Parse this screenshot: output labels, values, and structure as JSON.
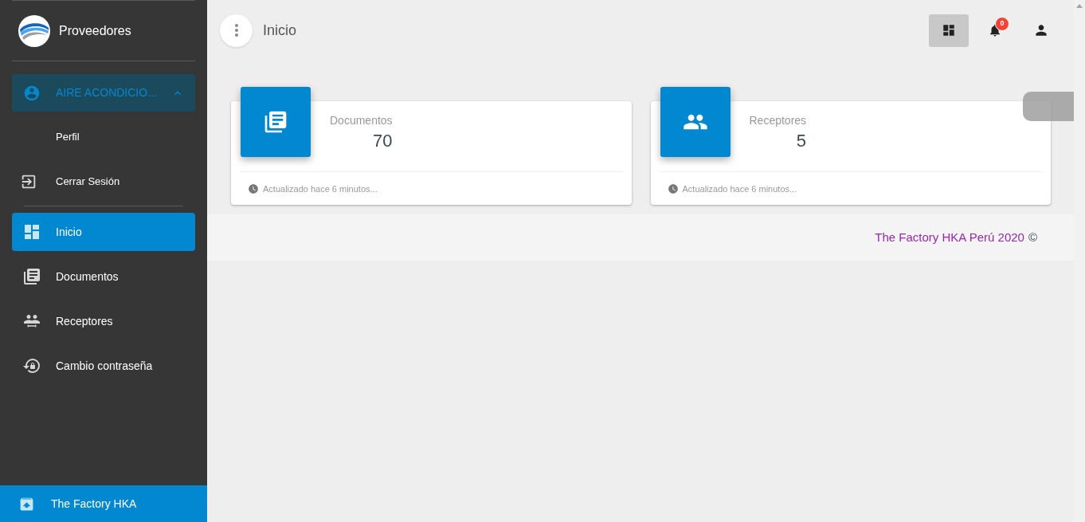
{
  "sidebar": {
    "brand": {
      "title": "Proveedores"
    },
    "user": {
      "name": "AIRE ACONDICIO...",
      "expanded": true,
      "submenu": [
        {
          "label": "Perfil",
          "kind": "plain"
        },
        {
          "label": "Cerrar Sesión",
          "kind": "logout"
        }
      ]
    },
    "items": [
      {
        "label": "Inicio",
        "selected": true
      },
      {
        "label": "Documentos",
        "selected": false
      },
      {
        "label": "Receptores",
        "selected": false
      },
      {
        "label": "Cambio contraseña",
        "selected": false
      }
    ],
    "footer": {
      "label": "The Factory HKA"
    }
  },
  "topbar": {
    "title": "Inicio",
    "dashboard_selected": true,
    "notifications": "0"
  },
  "cards": [
    {
      "title": "Documentos",
      "value": "70",
      "footer": "Actualizado hace 6 minutos..."
    },
    {
      "title": "Receptores",
      "value": "5",
      "footer": "Actualizado hace 6 minutos..."
    }
  ],
  "page_footer": {
    "text": "The Factory HKA Perú 2020",
    "symbol": "©"
  }
}
